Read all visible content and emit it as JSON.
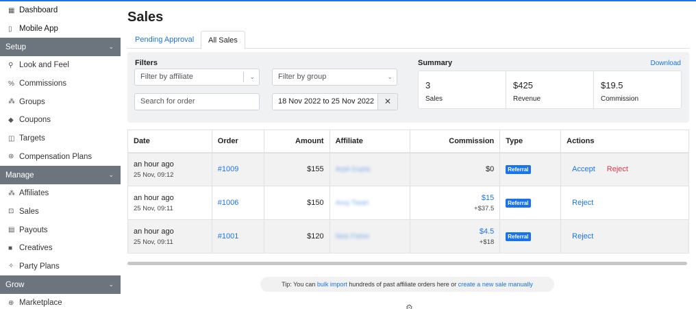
{
  "sidebar": {
    "items": [
      {
        "label": "Dashboard",
        "icon": "▦"
      },
      {
        "label": "Mobile App",
        "icon": "▯"
      },
      {
        "label": "Setup",
        "group": true
      },
      {
        "label": "Look and Feel",
        "icon": "⚲"
      },
      {
        "label": "Commissions",
        "icon": "%"
      },
      {
        "label": "Groups",
        "icon": "⁂"
      },
      {
        "label": "Coupons",
        "icon": "◆"
      },
      {
        "label": "Targets",
        "icon": "◫"
      },
      {
        "label": "Compensation Plans",
        "icon": "⊛"
      },
      {
        "label": "Manage",
        "group": true
      },
      {
        "label": "Affiliates",
        "icon": "⁂"
      },
      {
        "label": "Sales",
        "icon": "⊡"
      },
      {
        "label": "Payouts",
        "icon": "▤"
      },
      {
        "label": "Creatives",
        "icon": "■"
      },
      {
        "label": "Party Plans",
        "icon": "✧"
      },
      {
        "label": "Grow",
        "group": true
      },
      {
        "label": "Marketplace",
        "icon": "⊕"
      }
    ],
    "chevron": "⌄"
  },
  "page": {
    "title": "Sales",
    "tabs": {
      "pending": "Pending Approval",
      "all": "All Sales"
    }
  },
  "filters": {
    "heading": "Filters",
    "affiliate_placeholder": "Filter by affiliate",
    "group_placeholder": "Filter by group",
    "order_placeholder": "Search for order",
    "date_range": "18 Nov 2022 to 25 Nov 2022",
    "clear": "✕"
  },
  "summary": {
    "heading": "Summary",
    "download": "Download",
    "boxes": [
      {
        "value": "3",
        "label": "Sales"
      },
      {
        "value": "$425",
        "label": "Revenue"
      },
      {
        "value": "$19.5",
        "label": "Commission"
      }
    ]
  },
  "table": {
    "headers": {
      "date": "Date",
      "order": "Order",
      "amount": "Amount",
      "affiliate": "Affiliate",
      "commission": "Commission",
      "type": "Type",
      "actions": "Actions"
    },
    "rows": [
      {
        "date": "an hour ago",
        "time": "25 Nov, 09:12",
        "order": "#1009",
        "amount": "$155",
        "affiliate": "Arpit Gupta",
        "commission": "$0",
        "commission_sub": "",
        "type": "Referral",
        "accept": "Accept",
        "reject": "Reject"
      },
      {
        "date": "an hour ago",
        "time": "25 Nov, 09:11",
        "order": "#1006",
        "amount": "$150",
        "affiliate": "Anuj Tiwari",
        "commission": "$15",
        "commission_sub": "+$37.5",
        "type": "Referral",
        "accept": "",
        "reject": "Reject"
      },
      {
        "date": "an hour ago",
        "time": "25 Nov, 09:11",
        "order": "#1001",
        "amount": "$120",
        "affiliate": "Nick Fisher",
        "commission": "$4.5",
        "commission_sub": "+$18",
        "type": "Referral",
        "accept": "",
        "reject": "Reject"
      }
    ]
  },
  "tip": {
    "prefix": "Tip: You can ",
    "link1": "bulk import",
    "middle": " hundreds of past affiliate orders here or ",
    "link2": "create a new sale manually"
  },
  "footer_icon": "⚙"
}
